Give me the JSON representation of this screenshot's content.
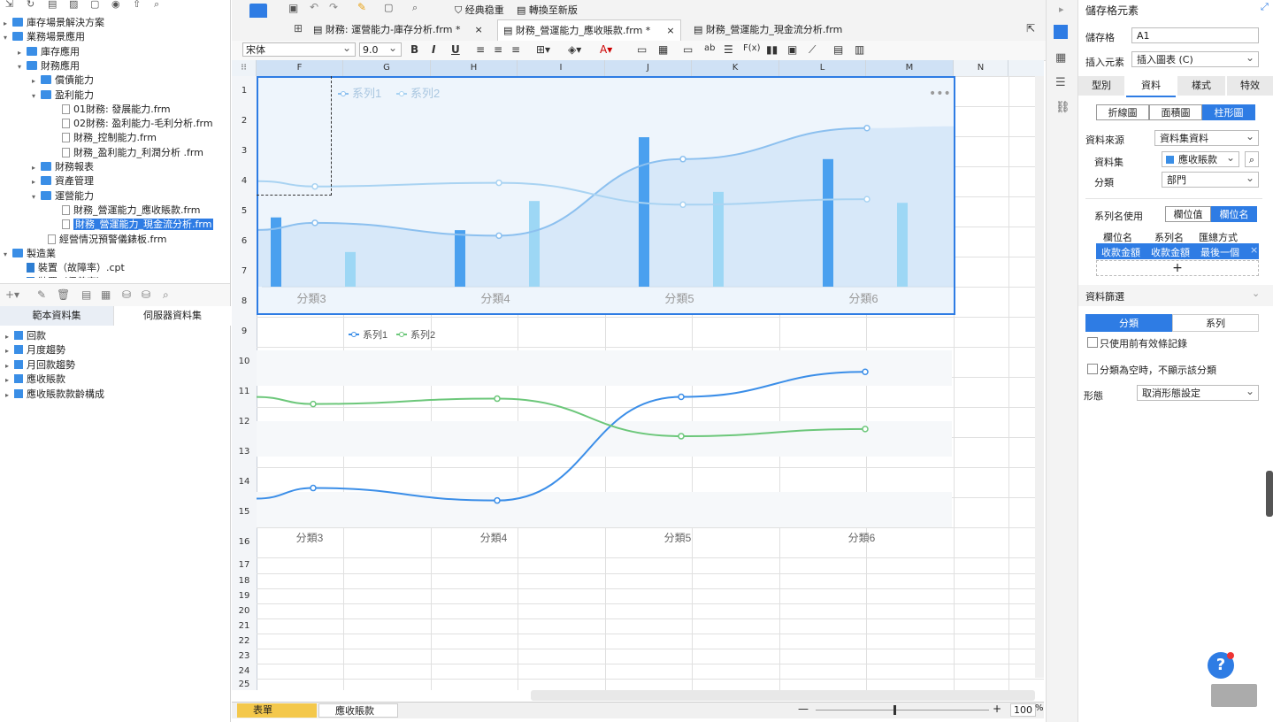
{
  "tree": {
    "nodes": [
      {
        "label": "庫存場景解決方案",
        "type": "folder",
        "arrow": "▸"
      },
      {
        "label": "業務場景應用",
        "type": "folder",
        "arrow": "▾"
      },
      {
        "label": "庫存應用",
        "type": "folder",
        "arrow": "▸"
      },
      {
        "label": "財務應用",
        "type": "folder",
        "arrow": "▾"
      },
      {
        "label": "償債能力",
        "type": "folder",
        "arrow": "▸"
      },
      {
        "label": "盈利能力",
        "type": "folder",
        "arrow": "▾"
      },
      {
        "label": "01財務: 發展能力.frm",
        "type": "file",
        "arrow": ""
      },
      {
        "label": "02財務: 盈利能力-毛利分析.frm",
        "type": "file",
        "arrow": ""
      },
      {
        "label": "財務_控制能力.frm",
        "type": "file",
        "arrow": ""
      },
      {
        "label": "財務_盈利能力_利潤分析 .frm",
        "type": "file",
        "arrow": ""
      },
      {
        "label": "財務報表",
        "type": "folder",
        "arrow": "▸"
      },
      {
        "label": "資產管理",
        "type": "folder",
        "arrow": "▸"
      },
      {
        "label": "運營能力",
        "type": "folder",
        "arrow": "▾"
      },
      {
        "label": "財務_營運能力_應收賬款.frm",
        "type": "file",
        "arrow": ""
      },
      {
        "label": "財務_營運能力_現金流分析.frm",
        "type": "file",
        "arrow": "",
        "selected": true
      },
      {
        "label": "經營情況預警儀錶板.frm",
        "type": "file",
        "arrow": ""
      },
      {
        "label": "製造業",
        "type": "folder",
        "arrow": "▾"
      },
      {
        "label": "裝置（故障率）.cpt",
        "type": "cpt",
        "arrow": ""
      },
      {
        "label": "裝置（保養率）",
        "type": "cpt",
        "arrow": ""
      }
    ]
  },
  "datasets": {
    "tabs": [
      "範本資料集",
      "伺服器資料集"
    ],
    "items": [
      "回款",
      "月度趨勢",
      "月回款趨勢",
      "應收賬款",
      "應收賬款款齡構成"
    ]
  },
  "toolbar": {
    "classic": "经典稳重",
    "convert": "轉換至新版"
  },
  "tabs": [
    {
      "label": "財務: 運營能力-庫存分析.frm *"
    },
    {
      "label": "財務_營運能力_應收賬款.frm *"
    },
    {
      "label": "財務_營運能力_現金流分析.frm"
    }
  ],
  "format": {
    "font": "宋体",
    "size": "9.0",
    "bold": "B",
    "italic": "I",
    "underline": "U"
  },
  "sheet": {
    "columns": [
      "F",
      "G",
      "H",
      "I",
      "J",
      "K",
      "L",
      "M",
      "N"
    ],
    "rows": [
      "1",
      "2",
      "3",
      "4",
      "5",
      "6",
      "7",
      "8",
      "9",
      "10",
      "11",
      "12",
      "13",
      "14",
      "15",
      "16",
      "17",
      "18",
      "19",
      "20",
      "21",
      "22",
      "23",
      "24",
      "25"
    ],
    "tabs": [
      "表單",
      "應收賬款"
    ],
    "zoom": "100",
    "zoom_unit": "%"
  },
  "chart_data": [
    {
      "type": "bar",
      "categories": [
        "分類3",
        "分類4",
        "分類5",
        "分類6"
      ],
      "series": [
        {
          "name": "系列1",
          "values": [
            38,
            31,
            82,
            70
          ]
        },
        {
          "name": "系列2",
          "values": [
            19,
            47,
            52,
            46
          ]
        }
      ],
      "overlay_lines": [
        {
          "name": "系列1",
          "values": [
            35,
            28,
            70,
            87
          ]
        },
        {
          "name": "系列2",
          "values": [
            55,
            57,
            45,
            48
          ]
        }
      ],
      "legend": "top-left",
      "colors": [
        "#4aa0ef",
        "#9dd7f5"
      ]
    },
    {
      "type": "line",
      "categories": [
        "分類3",
        "分類4",
        "分類5",
        "分類6"
      ],
      "series": [
        {
          "name": "系列1",
          "values": [
            23,
            16,
            74,
            88
          ]
        },
        {
          "name": "系列2",
          "values": [
            70,
            73,
            52,
            56
          ]
        }
      ],
      "legend": "top-left",
      "colors": [
        "#3b8ee8",
        "#6cc77a"
      ]
    }
  ],
  "panel": {
    "header": "儲存格元素",
    "cell_label": "儲存格",
    "cell_value": "A1",
    "insert_label": "插入元素",
    "insert_value": "插入圖表 (C)",
    "tabs": [
      "型別",
      "資料",
      "樣式",
      "特效"
    ],
    "chart_types": [
      "折線圖",
      "面積圖",
      "柱形圖"
    ],
    "source_label": "資料來源",
    "source_value": "資料集資料",
    "dataset_label": "資料集",
    "dataset_value": "應收賬款",
    "category_label": "分類",
    "category_value": "部門",
    "seriesname_label": "系列名使用",
    "seriesname_opts": [
      "欄位值",
      "欄位名"
    ],
    "table_headers": [
      "欄位名",
      "系列名",
      "匯總方式"
    ],
    "table_row": [
      "收款金額",
      "收款金額",
      "最後一個"
    ],
    "add": "+",
    "filter_label": "資料篩選",
    "filter_tabs": [
      "分類",
      "系列"
    ],
    "check1": "只使用前有效條記錄",
    "check2": "分類為空時，不顯示該分類",
    "shape_label": "形態",
    "shape_value": "取消形態設定",
    "help": "?"
  }
}
